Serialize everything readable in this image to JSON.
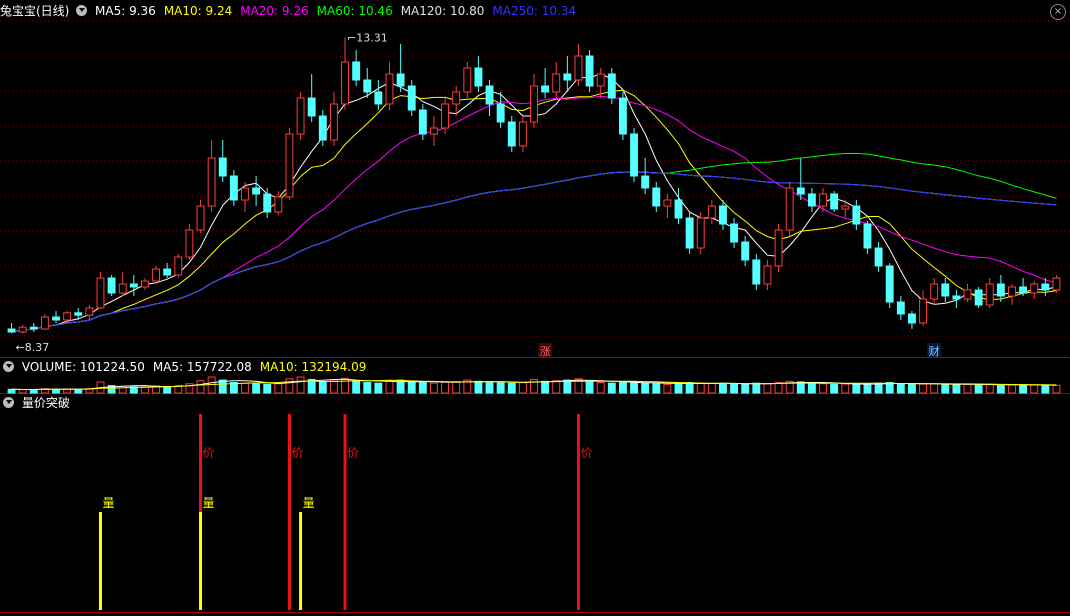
{
  "main_panel": {
    "stock_name": "兔宝宝(日线)",
    "ma_labels": [
      {
        "text": "MA5: 9.36",
        "color": "#ffffff"
      },
      {
        "text": "MA10: 9.24",
        "color": "#ffff00"
      },
      {
        "text": "MA20: 9.26",
        "color": "#ff00ff"
      },
      {
        "text": "MA60: 10.46",
        "color": "#00ff00"
      },
      {
        "text": "MA120: 10.80",
        "color": "#e0e0e0"
      },
      {
        "text": "MA250: 10.34",
        "color": "#3333ff"
      }
    ],
    "high_label": "13.31",
    "low_label": "8.37",
    "markers": [
      {
        "text": "涨",
        "candle": 48
      },
      {
        "text": "财",
        "candle": 83
      }
    ]
  },
  "volume_panel": {
    "labels": [
      {
        "text": "VOLUME: 101224.50",
        "color": "#ffffff"
      },
      {
        "text": "MA5: 157722.08",
        "color": "#ffffff"
      },
      {
        "text": "MA10: 132194.09",
        "color": "#ffff00"
      }
    ]
  },
  "indicator_panel": {
    "title": "量价突破",
    "volume_signal_label": "量",
    "price_signal_label": "价",
    "volume_signals": [
      8,
      17,
      26
    ],
    "price_signals": [
      17,
      25,
      30,
      51
    ]
  },
  "colors": {
    "up": "#ff3b3b",
    "down": "#54ffff",
    "grid": "#8b0000",
    "signal_yellow": "#ffff00",
    "signal_red": "#ee1111"
  },
  "chart_data": {
    "type": "candlestick",
    "candles": [
      [
        8.45,
        8.55,
        8.38,
        8.4
      ],
      [
        8.4,
        8.52,
        8.37,
        8.48
      ],
      [
        8.48,
        8.55,
        8.4,
        8.45
      ],
      [
        8.45,
        8.7,
        8.43,
        8.65
      ],
      [
        8.65,
        8.75,
        8.55,
        8.6
      ],
      [
        8.6,
        8.75,
        8.55,
        8.72
      ],
      [
        8.72,
        8.8,
        8.6,
        8.68
      ],
      [
        8.68,
        8.85,
        8.6,
        8.8
      ],
      [
        8.8,
        9.4,
        8.78,
        9.3
      ],
      [
        9.3,
        9.35,
        9.0,
        9.05
      ],
      [
        9.05,
        9.4,
        9.0,
        9.2
      ],
      [
        9.2,
        9.35,
        9.0,
        9.15
      ],
      [
        9.15,
        9.3,
        9.1,
        9.25
      ],
      [
        9.25,
        9.5,
        9.2,
        9.45
      ],
      [
        9.45,
        9.55,
        9.3,
        9.35
      ],
      [
        9.35,
        9.7,
        9.3,
        9.65
      ],
      [
        9.65,
        10.2,
        9.6,
        10.1
      ],
      [
        10.1,
        10.6,
        10.05,
        10.5
      ],
      [
        10.5,
        11.6,
        10.4,
        11.3
      ],
      [
        11.3,
        11.6,
        10.9,
        11.0
      ],
      [
        11.0,
        11.1,
        10.5,
        10.6
      ],
      [
        10.6,
        10.9,
        10.4,
        10.8
      ],
      [
        10.8,
        11.0,
        10.5,
        10.7
      ],
      [
        10.7,
        10.8,
        10.3,
        10.4
      ],
      [
        10.4,
        10.75,
        10.35,
        10.65
      ],
      [
        10.65,
        11.8,
        10.6,
        11.7
      ],
      [
        11.7,
        12.4,
        11.6,
        12.3
      ],
      [
        12.3,
        12.7,
        11.9,
        12.0
      ],
      [
        12.0,
        12.1,
        11.5,
        11.6
      ],
      [
        11.6,
        12.4,
        11.5,
        12.2
      ],
      [
        12.2,
        13.31,
        12.1,
        12.9
      ],
      [
        12.9,
        13.1,
        12.5,
        12.6
      ],
      [
        12.6,
        12.8,
        12.3,
        12.4
      ],
      [
        12.4,
        12.6,
        12.1,
        12.2
      ],
      [
        12.2,
        12.9,
        12.1,
        12.7
      ],
      [
        12.7,
        13.2,
        12.4,
        12.5
      ],
      [
        12.5,
        12.6,
        12.0,
        12.1
      ],
      [
        12.1,
        12.2,
        11.6,
        11.7
      ],
      [
        11.7,
        12.0,
        11.5,
        11.8
      ],
      [
        11.8,
        12.3,
        11.7,
        12.2
      ],
      [
        12.2,
        12.5,
        12.0,
        12.4
      ],
      [
        12.4,
        12.9,
        12.3,
        12.8
      ],
      [
        12.8,
        13.0,
        12.4,
        12.5
      ],
      [
        12.5,
        12.6,
        12.0,
        12.2
      ],
      [
        12.2,
        12.4,
        11.8,
        11.9
      ],
      [
        11.9,
        12.0,
        11.4,
        11.5
      ],
      [
        11.5,
        12.0,
        11.4,
        11.9
      ],
      [
        11.9,
        12.7,
        11.8,
        12.5
      ],
      [
        12.5,
        12.8,
        12.3,
        12.4
      ],
      [
        12.4,
        12.9,
        12.3,
        12.7
      ],
      [
        12.7,
        13.0,
        12.4,
        12.6
      ],
      [
        12.6,
        13.2,
        12.5,
        13.0
      ],
      [
        13.0,
        13.1,
        12.4,
        12.5
      ],
      [
        12.5,
        12.8,
        12.3,
        12.7
      ],
      [
        12.7,
        12.8,
        12.2,
        12.3
      ],
      [
        12.3,
        12.4,
        11.6,
        11.7
      ],
      [
        11.7,
        11.8,
        10.9,
        11.0
      ],
      [
        11.0,
        11.3,
        10.7,
        10.8
      ],
      [
        10.8,
        10.9,
        10.4,
        10.5
      ],
      [
        10.5,
        10.7,
        10.3,
        10.6
      ],
      [
        10.6,
        10.8,
        10.2,
        10.3
      ],
      [
        10.3,
        10.4,
        9.7,
        9.8
      ],
      [
        9.8,
        10.4,
        9.7,
        10.3
      ],
      [
        10.3,
        10.6,
        10.2,
        10.5
      ],
      [
        10.5,
        10.6,
        10.1,
        10.2
      ],
      [
        10.2,
        10.3,
        9.8,
        9.9
      ],
      [
        9.9,
        10.0,
        9.5,
        9.6
      ],
      [
        9.6,
        9.7,
        9.1,
        9.2
      ],
      [
        9.2,
        9.6,
        9.1,
        9.5
      ],
      [
        9.5,
        10.2,
        9.4,
        10.1
      ],
      [
        10.1,
        10.9,
        10.0,
        10.8
      ],
      [
        10.8,
        11.3,
        10.6,
        10.7
      ],
      [
        10.7,
        10.8,
        10.4,
        10.5
      ],
      [
        10.5,
        10.8,
        10.4,
        10.7
      ],
      [
        10.7,
        10.75,
        10.4,
        10.45
      ],
      [
        10.45,
        10.6,
        10.3,
        10.5
      ],
      [
        10.5,
        10.6,
        10.1,
        10.2
      ],
      [
        10.2,
        10.25,
        9.7,
        9.8
      ],
      [
        9.8,
        9.9,
        9.4,
        9.5
      ],
      [
        9.5,
        9.55,
        8.8,
        8.9
      ],
      [
        8.9,
        9.0,
        8.6,
        8.7
      ],
      [
        8.7,
        8.75,
        8.45,
        8.55
      ],
      [
        8.55,
        9.1,
        8.5,
        8.95
      ],
      [
        8.95,
        9.3,
        8.85,
        9.2
      ],
      [
        9.2,
        9.3,
        8.9,
        9.0
      ],
      [
        9.0,
        9.1,
        8.8,
        8.95
      ],
      [
        8.95,
        9.2,
        8.9,
        9.1
      ],
      [
        9.1,
        9.15,
        8.8,
        8.85
      ],
      [
        8.85,
        9.3,
        8.8,
        9.2
      ],
      [
        9.2,
        9.35,
        8.9,
        9.0
      ],
      [
        9.0,
        9.2,
        8.85,
        9.15
      ],
      [
        9.15,
        9.3,
        9.0,
        9.05
      ],
      [
        9.05,
        9.25,
        8.95,
        9.2
      ],
      [
        9.2,
        9.3,
        9.0,
        9.1
      ],
      [
        9.1,
        9.35,
        9.05,
        9.3
      ]
    ],
    "volume": [
      60,
      55,
      58,
      70,
      62,
      65,
      60,
      72,
      180,
      120,
      110,
      100,
      95,
      115,
      105,
      120,
      150,
      200,
      260,
      210,
      170,
      160,
      150,
      140,
      150,
      230,
      260,
      220,
      180,
      210,
      240,
      200,
      170,
      160,
      190,
      210,
      180,
      170,
      160,
      175,
      185,
      210,
      190,
      170,
      165,
      160,
      170,
      220,
      190,
      200,
      210,
      230,
      190,
      170,
      160,
      170,
      180,
      160,
      150,
      140,
      150,
      170,
      160,
      155,
      150,
      140,
      150,
      160,
      150,
      170,
      190,
      180,
      160,
      150,
      140,
      145,
      140,
      150,
      160,
      170,
      150,
      140,
      145,
      150,
      140,
      135,
      140,
      130,
      140,
      135,
      130,
      125,
      130,
      128,
      125
    ],
    "ma_lines": [
      {
        "name": "MA5",
        "color": "#ffffff"
      },
      {
        "name": "MA10",
        "color": "#ffff00"
      },
      {
        "name": "MA20",
        "color": "#ff00ff"
      },
      {
        "name": "MA60",
        "color": "#00ff00"
      },
      {
        "name": "MA120",
        "color": "#e0e0e0"
      },
      {
        "name": "MA250",
        "color": "#3333ff"
      }
    ],
    "price_range": [
      8.1,
      13.6
    ]
  }
}
